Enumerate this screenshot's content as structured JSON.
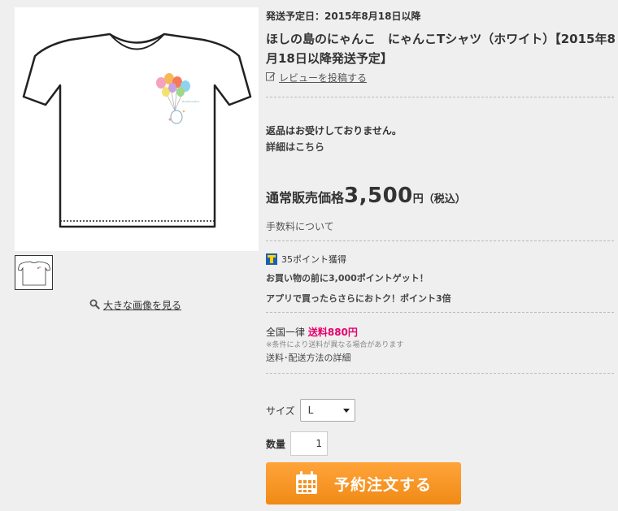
{
  "product": {
    "ship_date": "発送予定日：2015年8月18日以降",
    "title": "ほしの島のにゃんこ　にゃんこTシャツ（ホワイト）【2015年8月18日以降発送予定】",
    "review_link": "レビューを投稿する",
    "return_note": "返品はお受けしておりません。",
    "return_detail_link": "詳細はこちら"
  },
  "gallery": {
    "big_image_link": "大きな画像を見る"
  },
  "price": {
    "label": "通常販売価格",
    "value": "3,500",
    "unit": "円（税込）",
    "fee_link": "手数料について"
  },
  "points": {
    "earned": "35ポイント獲得",
    "promo1": "お買い物の前に3,000ポイントゲット！",
    "promo2": "アプリで買ったらさらにおトク！ポイント3倍"
  },
  "shipping": {
    "prefix": "全国一律",
    "fee": "送料880円",
    "note": "※条件により送料が異なる場合があります",
    "link": "送料･配送方法の詳細"
  },
  "options": {
    "size_label": "サイズ",
    "size_value": "L",
    "qty_label": "数量",
    "qty_value": "1"
  },
  "order_button": {
    "label": "予約注文する"
  },
  "colors": {
    "accent_orange": "#f59a2a",
    "shipping_fee_pink": "#e8006e"
  }
}
